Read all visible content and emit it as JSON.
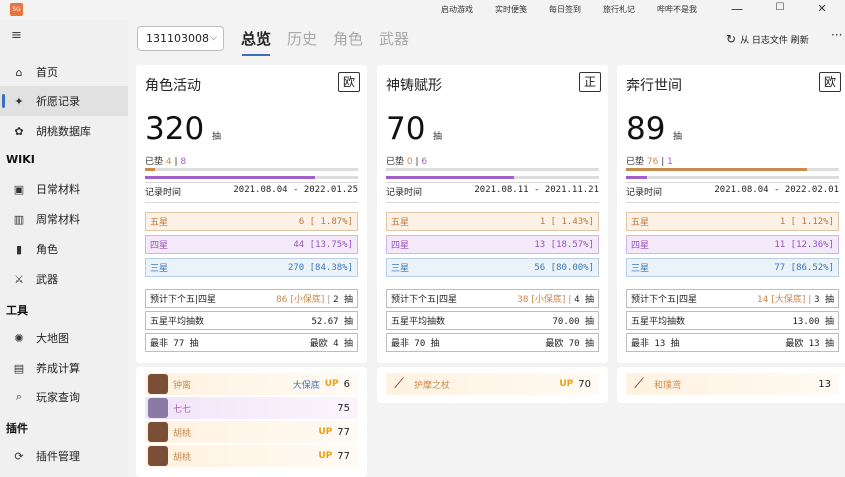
{
  "window": {
    "app_icon": "app-logo-icon",
    "top_links": [
      "启动游戏",
      "实时便笺",
      "每日签到",
      "旅行札记",
      "哔哔不是我"
    ],
    "controls": {
      "minimize": "—",
      "maximize": "☐",
      "close": "✕"
    }
  },
  "sidebar": {
    "menu_icon": "≡",
    "items": [
      {
        "label": "首页",
        "icon": "home-icon",
        "glyph": "⌂"
      },
      {
        "label": "祈愿记录",
        "icon": "wish-icon",
        "glyph": "✦"
      },
      {
        "label": "胡桃数据库",
        "icon": "database-icon",
        "glyph": "✿"
      },
      {
        "label": "日常材料",
        "icon": "daily-material-icon",
        "glyph": "▣"
      },
      {
        "label": "周常材料",
        "icon": "weekly-material-icon",
        "glyph": "▥"
      },
      {
        "label": "角色",
        "icon": "character-icon",
        "glyph": "▮"
      },
      {
        "label": "武器",
        "icon": "weapon-icon",
        "glyph": "⚔"
      },
      {
        "label": "大地图",
        "icon": "map-icon",
        "glyph": "✺"
      },
      {
        "label": "养成计算",
        "icon": "calculator-icon",
        "glyph": "▤"
      },
      {
        "label": "玩家查询",
        "icon": "search-icon",
        "glyph": "⌕"
      },
      {
        "label": "插件管理",
        "icon": "plugin-icon",
        "glyph": "⟳"
      }
    ],
    "headers": [
      "WIKI",
      "工具",
      "插件"
    ]
  },
  "toolbar": {
    "uid": "131103008",
    "tabs": [
      "总览",
      "历史",
      "角色",
      "武器"
    ],
    "refresh_label": "从 日志文件 刷新",
    "more": "···"
  },
  "cards": [
    {
      "title": "角色活动",
      "tag": "欧",
      "total": "320",
      "unit": "抽",
      "pity_label": "已垫",
      "pity5": "4",
      "pity4": "8",
      "pity_sep": "|",
      "pity5_fraction": 0.045,
      "pity4_fraction": 0.8,
      "time_label": "记录时间",
      "time_range": "2021.08.04 - 2022.01.25",
      "stars": [
        {
          "label": "五星",
          "value": "6 [ 1.87%]"
        },
        {
          "label": "四星",
          "value": "44 [13.75%]"
        },
        {
          "label": "三星",
          "value": "270 [84.38%]"
        }
      ],
      "predict_label": "预计下个五|四星",
      "predict_value": "86 [小保底]",
      "predict_sep": "|",
      "predict_4": "2 抽",
      "avg_label": "五星平均抽数",
      "avg_value": "52.67 抽",
      "worst_label": "最非 77 抽",
      "best_label": "最欧 4 抽"
    },
    {
      "title": "神铸赋形",
      "tag": "正",
      "total": "70",
      "unit": "抽",
      "pity_label": "已垫",
      "pity5": "0",
      "pity4": "6",
      "pity_sep": "|",
      "pity5_fraction": 0.0,
      "pity4_fraction": 0.6,
      "time_label": "记录时间",
      "time_range": "2021.08.11 - 2021.11.21",
      "stars": [
        {
          "label": "五星",
          "value": "1 [ 1.43%]"
        },
        {
          "label": "四星",
          "value": "13 [18.57%]"
        },
        {
          "label": "三星",
          "value": "56 [80.00%]"
        }
      ],
      "predict_label": "预计下个五|四星",
      "predict_value": "38 [小保底]",
      "predict_sep": "|",
      "predict_4": "4 抽",
      "avg_label": "五星平均抽数",
      "avg_value": "70.00 抽",
      "worst_label": "最非 70 抽",
      "best_label": "最欧 70 抽"
    },
    {
      "title": "奔行世间",
      "tag": "欧",
      "total": "89",
      "unit": "抽",
      "pity_label": "已垫",
      "pity5": "76",
      "pity4": "1",
      "pity_sep": "|",
      "pity5_fraction": 0.85,
      "pity4_fraction": 0.1,
      "time_label": "记录时间",
      "time_range": "2021.08.04 - 2022.02.01",
      "stars": [
        {
          "label": "五星",
          "value": "1 [ 1.12%]"
        },
        {
          "label": "四星",
          "value": "11 [12.36%]"
        },
        {
          "label": "三星",
          "value": "77 [86.52%]"
        }
      ],
      "predict_label": "预计下个五|四星",
      "predict_value": "14 [大保底]",
      "predict_sep": "|",
      "predict_4": "3 抽",
      "avg_label": "五星平均抽数",
      "avg_value": "13.00 抽",
      "worst_label": "最非 13 抽",
      "best_label": "最欧 13 抽"
    }
  ],
  "history": [
    [
      {
        "name": "钟离",
        "tag": "大保底",
        "up": "UP",
        "count": "6",
        "rarity": "gold",
        "icon": "character-avatar-icon"
      },
      {
        "name": "七七",
        "tag": "",
        "up": "",
        "count": "75",
        "rarity": "purple",
        "icon": "character-avatar-icon"
      },
      {
        "name": "胡桃",
        "tag": "",
        "up": "UP",
        "count": "77",
        "rarity": "gold",
        "icon": "character-avatar-icon"
      },
      {
        "name": "胡桃",
        "tag": "",
        "up": "UP",
        "count": "77",
        "rarity": "gold",
        "icon": "character-avatar-icon"
      }
    ],
    [
      {
        "name": "护摩之杖",
        "tag": "",
        "up": "UP",
        "count": "70",
        "rarity": "gold",
        "icon": "weapon-spear-icon"
      }
    ],
    [
      {
        "name": "和璞鸢",
        "tag": "",
        "up": "",
        "count": "13",
        "rarity": "gold",
        "icon": "weapon-spear-icon"
      }
    ]
  ],
  "colors": {
    "five_star": "#c98a4b",
    "four_star": "#a45ec7",
    "three_star": "#3a78b5",
    "accent": "#3b6fc4",
    "up": "#e6a11c"
  }
}
